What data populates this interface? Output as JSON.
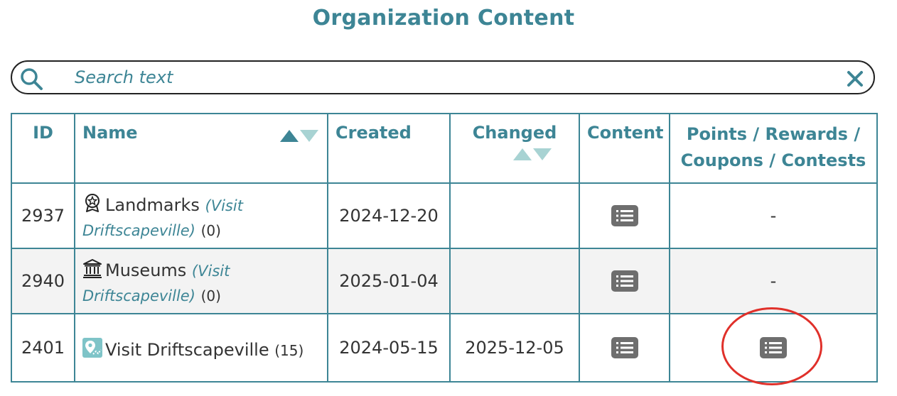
{
  "page": {
    "title": "Organization Content"
  },
  "search": {
    "placeholder": "Search text",
    "value": ""
  },
  "table": {
    "headers": {
      "id": "ID",
      "name": "Name",
      "created": "Created",
      "changed": "Changed",
      "content": "Content",
      "points_line1": "Points / Rewards /",
      "points_line2": "Coupons / Contests"
    },
    "rows": [
      {
        "id": "2937",
        "icon": "landmark-badge-icon",
        "name": "Landmarks",
        "visit_label": "(Visit Driftscapeville)",
        "count": "(0)",
        "created": "2024-12-20",
        "changed": "",
        "points": "-"
      },
      {
        "id": "2940",
        "icon": "museum-icon",
        "name": "Museums",
        "visit_label": "(Visit Driftscapeville)",
        "count": "(0)",
        "created": "2025-01-04",
        "changed": "",
        "points": "-"
      },
      {
        "id": "2401",
        "icon": "map-pin-icon",
        "name": "Visit Driftscapeville",
        "visit_label": "",
        "count": "(15)",
        "created": "2024-05-15",
        "changed": "2025-12-05",
        "points": ""
      }
    ]
  },
  "colors": {
    "accent": "#3d8595",
    "sort_light": "#a8d3d3",
    "button_gray": "#6e6e6e",
    "annotation": "#e0302a"
  }
}
